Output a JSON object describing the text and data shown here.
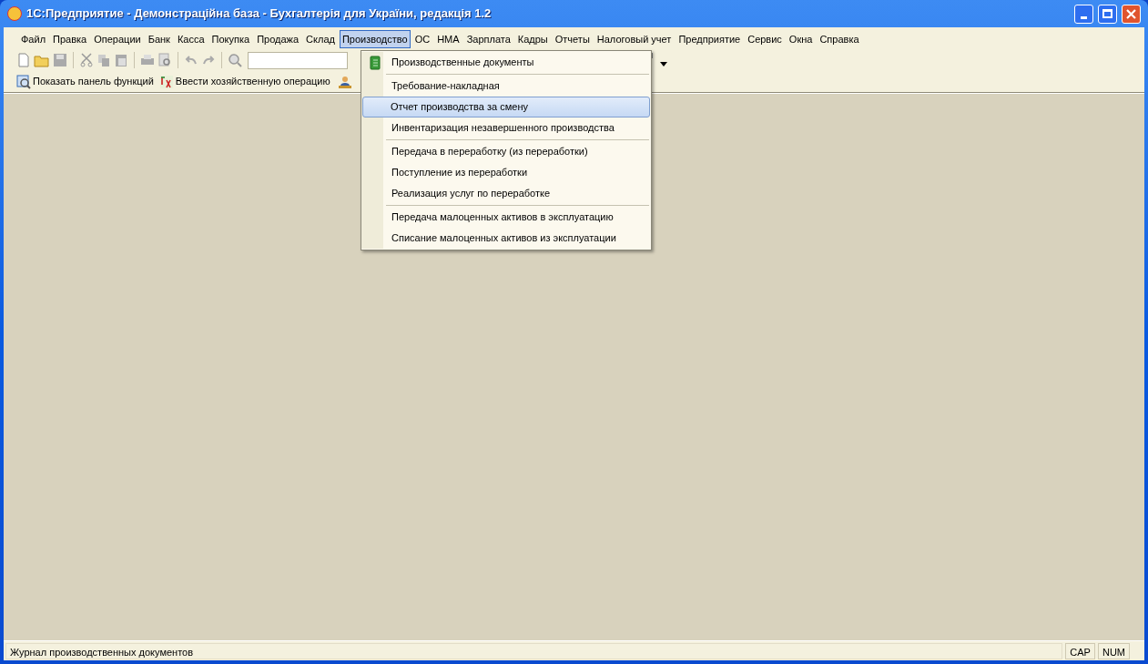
{
  "window": {
    "title": "1С:Предприятие - Демонстраційна база - Бухгалтерія для України, редакція 1.2"
  },
  "menu_bar": [
    {
      "label": "Файл",
      "selected": false
    },
    {
      "label": "Правка",
      "selected": false
    },
    {
      "label": "Операции",
      "selected": false
    },
    {
      "label": "Банк",
      "selected": false
    },
    {
      "label": "Касса",
      "selected": false
    },
    {
      "label": "Покупка",
      "selected": false
    },
    {
      "label": "Продажа",
      "selected": false
    },
    {
      "label": "Склад",
      "selected": false
    },
    {
      "label": "Производство",
      "selected": true
    },
    {
      "label": "ОС",
      "selected": false
    },
    {
      "label": "НМА",
      "selected": false
    },
    {
      "label": "Зарплата",
      "selected": false
    },
    {
      "label": "Кадры",
      "selected": false
    },
    {
      "label": "Отчеты",
      "selected": false
    },
    {
      "label": "Налоговый учет",
      "selected": false
    },
    {
      "label": "Предприятие",
      "selected": false
    },
    {
      "label": "Сервис",
      "selected": false
    },
    {
      "label": "Окна",
      "selected": false
    },
    {
      "label": "Справка",
      "selected": false
    }
  ],
  "function_toolbar": [
    {
      "label": "Показать панель функций",
      "kind": "panel"
    },
    {
      "label": "Ввести хозяйственную операцию",
      "kind": "operation"
    }
  ],
  "dropdown_menu": [
    {
      "label": "Производственные документы",
      "selected": false,
      "separator_before": false
    },
    {
      "label": "Требование-накладная",
      "selected": false,
      "separator_before": true
    },
    {
      "label": "Отчет производства за смену",
      "selected": true,
      "separator_before": false
    },
    {
      "label": "Инвентаризация незавершенного производства",
      "selected": false,
      "separator_before": false
    },
    {
      "label": "Передача в переработку (из переработки)",
      "selected": false,
      "separator_before": true
    },
    {
      "label": "Поступление из переработки",
      "selected": false,
      "separator_before": false
    },
    {
      "label": "Реализация услуг по переработке",
      "selected": false,
      "separator_before": false
    },
    {
      "label": "Передача малоценных активов в эксплуатацию",
      "selected": false,
      "separator_before": true
    },
    {
      "label": "Списание малоценных активов из эксплуатации",
      "selected": false,
      "separator_before": false
    }
  ],
  "status_bar": {
    "message": "Журнал производственных документов",
    "indicators": [
      "CAP",
      "NUM"
    ]
  }
}
